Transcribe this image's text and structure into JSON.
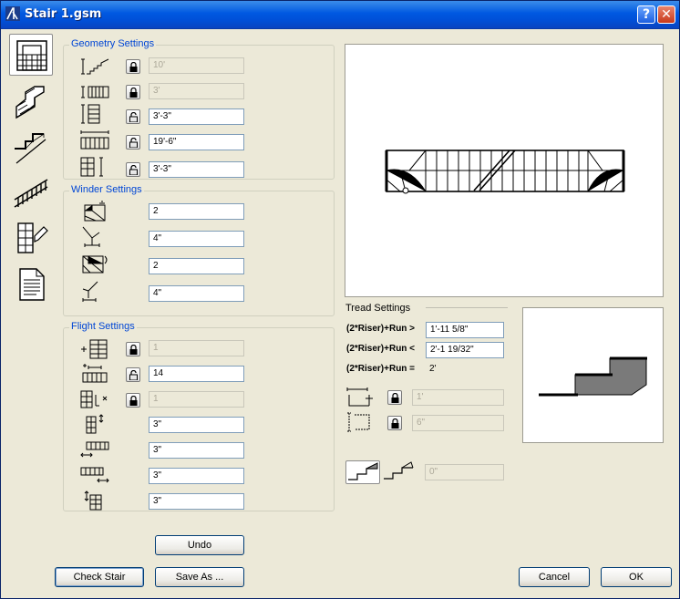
{
  "window": {
    "title": "Stair 1.gsm"
  },
  "geometry": {
    "label": "Geometry Settings",
    "rows": [
      {
        "icon": "stair-height-icon",
        "locked": true,
        "value": "10'",
        "disabled": true
      },
      {
        "icon": "stair-width-icon",
        "locked": true,
        "value": "3'",
        "disabled": true
      },
      {
        "icon": "flight-width-icon",
        "locked": false,
        "value": "3'-3\"",
        "disabled": false
      },
      {
        "icon": "stair-length-icon",
        "locked": false,
        "value": "19'-6\"",
        "disabled": false
      },
      {
        "icon": "landing-width-icon",
        "locked": false,
        "value": "3'-3\"",
        "disabled": false
      }
    ]
  },
  "winder": {
    "label": "Winder Settings",
    "rows": [
      {
        "icon": "winder-bottom-count-icon",
        "value": "2"
      },
      {
        "icon": "winder-bottom-offset-icon",
        "value": "4\""
      },
      {
        "icon": "winder-top-count-icon",
        "value": "2"
      },
      {
        "icon": "winder-top-offset-icon",
        "value": "4\""
      }
    ]
  },
  "flight": {
    "label": "Flight Settings",
    "rows": [
      {
        "icon": "riser-count-icon",
        "locked": true,
        "value": "1",
        "disabled": true
      },
      {
        "icon": "tread-count-icon",
        "locked": false,
        "value": "14",
        "disabled": false
      },
      {
        "icon": "landing-riser-icon",
        "locked": true,
        "value": "1",
        "disabled": true
      },
      {
        "icon": "riser-thickness-icon",
        "value": "3\"",
        "disabled": false
      },
      {
        "icon": "tread-nosing-icon",
        "value": "3\"",
        "disabled": false
      },
      {
        "icon": "tread-extension-icon",
        "value": "3\"",
        "disabled": false
      },
      {
        "icon": "stringer-offset-icon",
        "value": "3\"",
        "disabled": false
      }
    ]
  },
  "tread": {
    "label": "Tread Settings",
    "formulas": [
      {
        "label": "(2*Riser)+Run >",
        "value": "1'-11 5/8\""
      },
      {
        "label": "(2*Riser)+Run <",
        "value": "2'-1 19/32\""
      },
      {
        "label": "(2*Riser)+Run =",
        "value": "2'"
      }
    ],
    "rows": [
      {
        "icon": "tread-depth-icon",
        "locked": true,
        "value": "1'"
      },
      {
        "icon": "riser-height-icon",
        "locked": true,
        "value": "6\""
      }
    ],
    "nosing_value": "0\""
  },
  "tabs": [
    {
      "name": "tab-plan-view",
      "icon": "plan-view-icon",
      "active": true
    },
    {
      "name": "tab-stair-3d",
      "icon": "stair-3d-icon",
      "active": false
    },
    {
      "name": "tab-stair-profile",
      "icon": "stair-profile-icon",
      "active": false
    },
    {
      "name": "tab-railing",
      "icon": "railing-icon",
      "active": false
    },
    {
      "name": "tab-materials",
      "icon": "materials-icon",
      "active": false
    },
    {
      "name": "tab-listing",
      "icon": "document-icon",
      "active": false
    }
  ],
  "buttons": {
    "undo": "Undo",
    "check_stair": "Check Stair",
    "save_as": "Save As ...",
    "cancel": "Cancel",
    "ok": "OK"
  }
}
